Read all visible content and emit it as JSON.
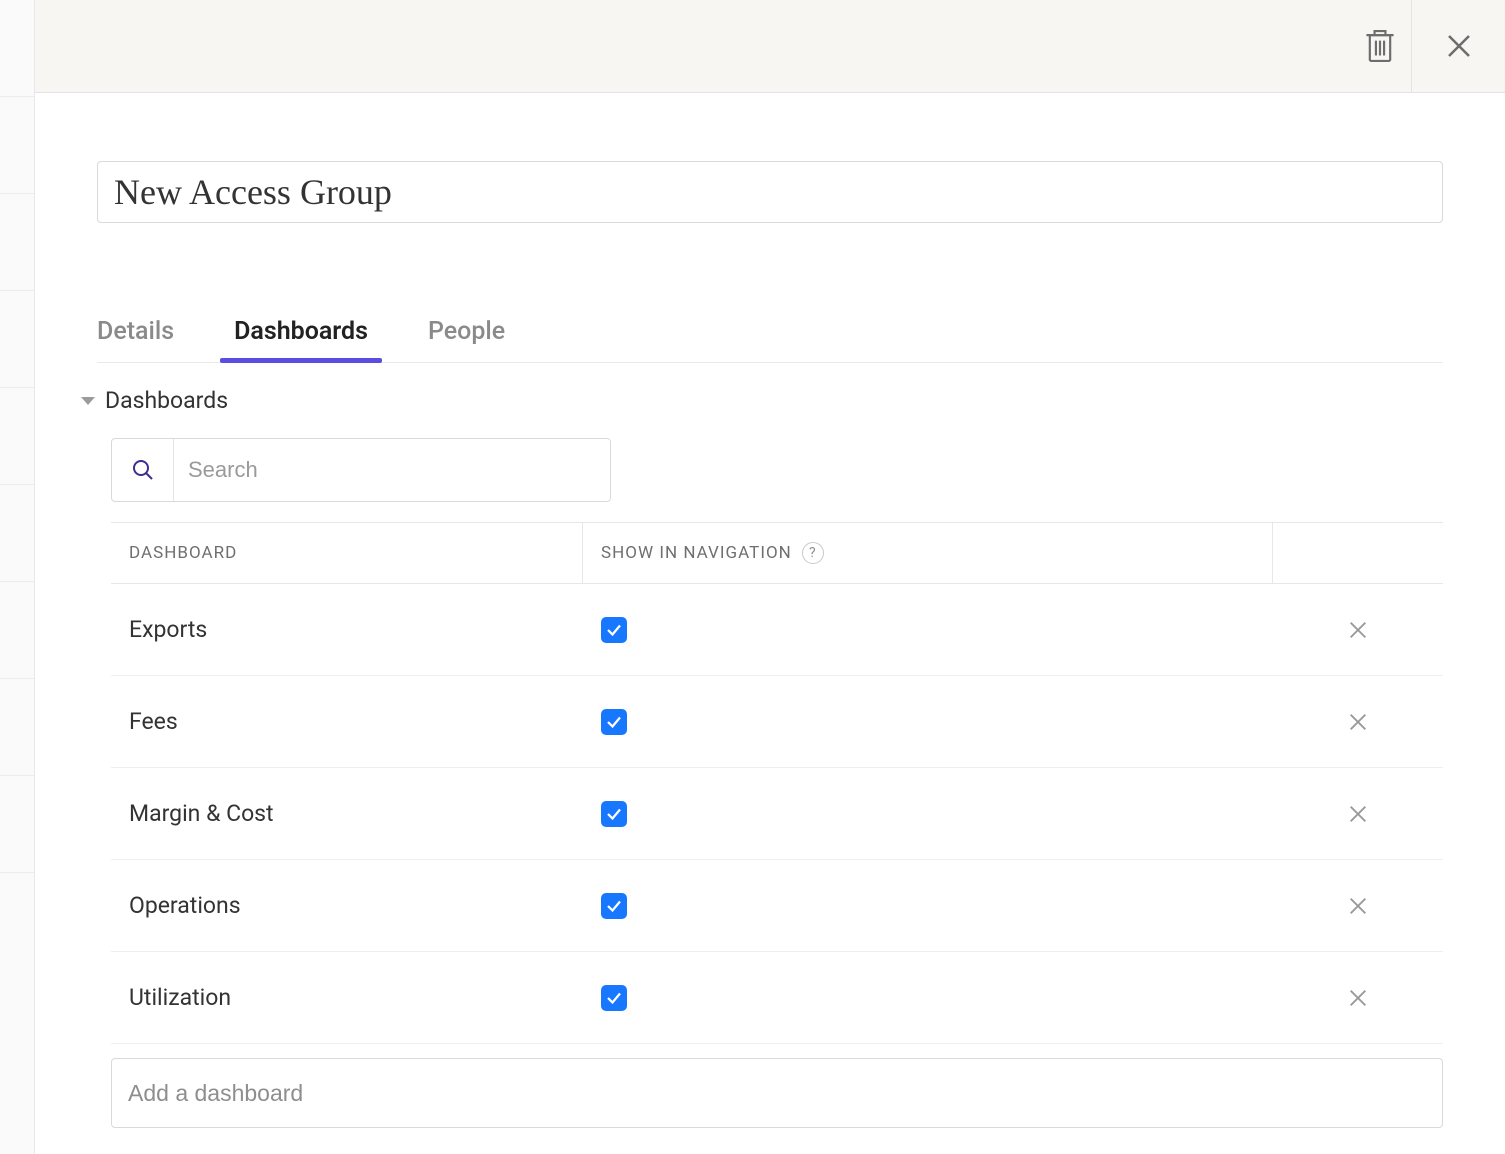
{
  "header": {
    "title_value": "New Access Group"
  },
  "tabs": [
    {
      "label": "Details",
      "active": false
    },
    {
      "label": "Dashboards",
      "active": true
    },
    {
      "label": "People",
      "active": false
    }
  ],
  "section": {
    "title": "Dashboards",
    "search_placeholder": "Search",
    "columns": {
      "name": "DASHBOARD",
      "show": "SHOW IN NAVIGATION",
      "help": "?"
    },
    "rows": [
      {
        "name": "Exports",
        "show_in_nav": true
      },
      {
        "name": "Fees",
        "show_in_nav": true
      },
      {
        "name": "Margin & Cost",
        "show_in_nav": true
      },
      {
        "name": "Operations",
        "show_in_nav": true
      },
      {
        "name": "Utilization",
        "show_in_nav": true
      }
    ],
    "add_placeholder": "Add a dashboard"
  }
}
